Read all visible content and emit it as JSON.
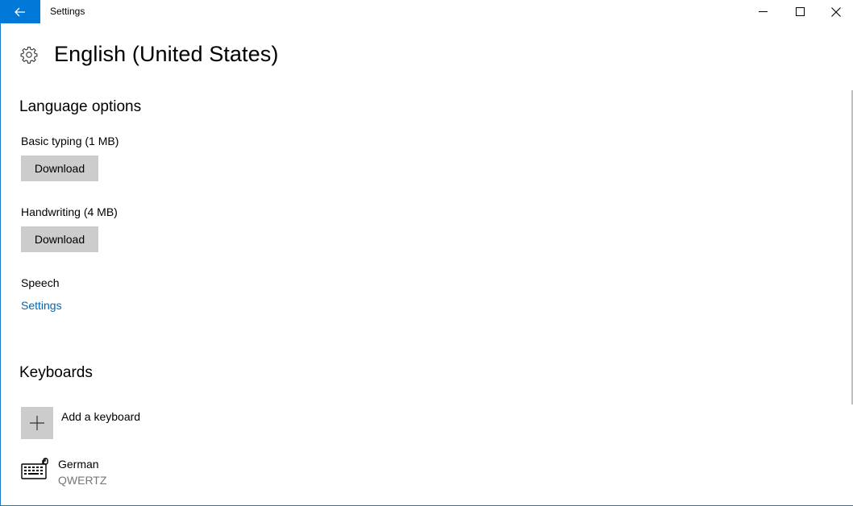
{
  "window": {
    "title": "Settings",
    "controls": [
      "minimize-icon",
      "maximize-icon",
      "close-icon"
    ]
  },
  "header": {
    "icon": "gear-icon",
    "title": "English (United States)"
  },
  "language_options": {
    "heading": "Language options",
    "basic_typing": {
      "label": "Basic typing (1 MB)",
      "button": "Download"
    },
    "handwriting": {
      "label": "Handwriting (4 MB)",
      "button": "Download"
    },
    "speech": {
      "label": "Speech",
      "link": "Settings"
    }
  },
  "keyboards": {
    "heading": "Keyboards",
    "add_label": "Add a keyboard",
    "items": [
      {
        "name": "German",
        "layout": "QWERTZ",
        "icon": "keyboard-icon"
      }
    ]
  },
  "colors": {
    "accent": "#0078d7",
    "link": "#0066b4",
    "button_bg": "#cccccc",
    "secondary_text": "#767676"
  }
}
